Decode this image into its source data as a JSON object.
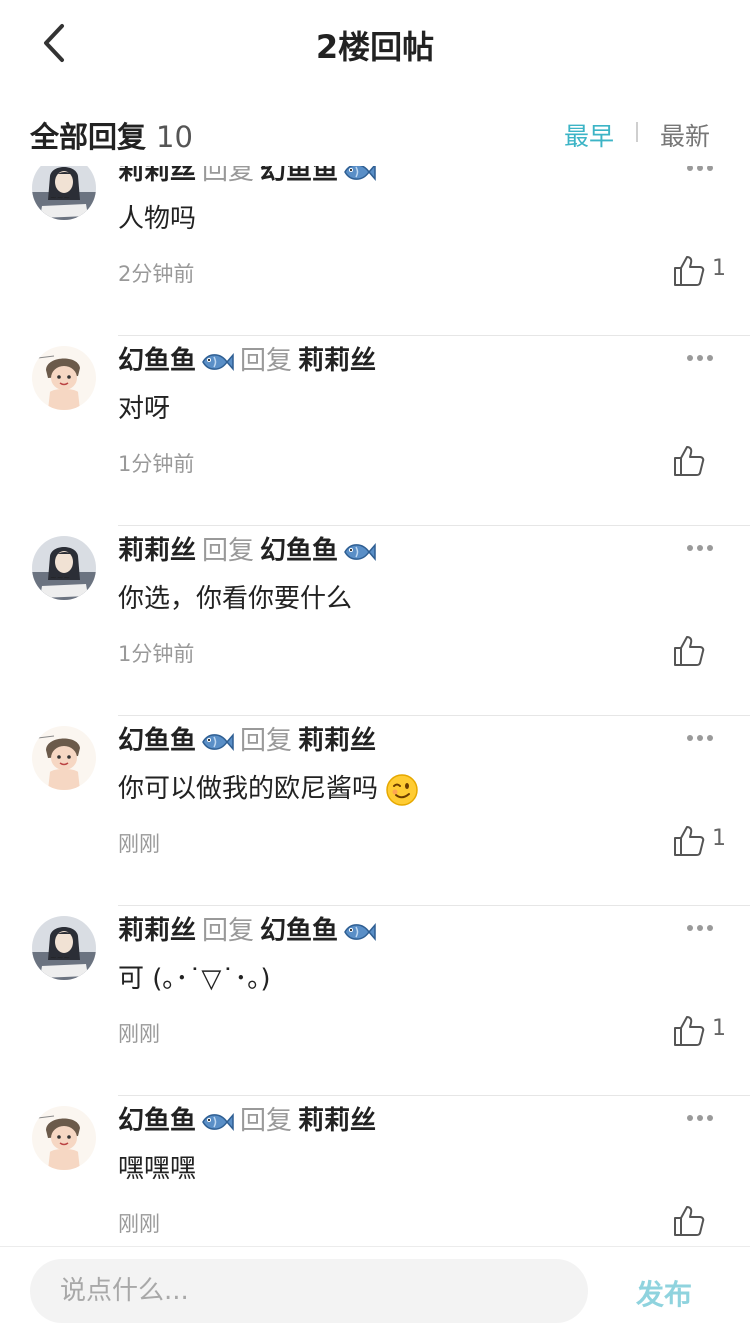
{
  "header": {
    "title": "2楼回帖"
  },
  "subheader": {
    "label": "全部回复",
    "count": "10",
    "sort_earliest": "最早",
    "sort_latest": "最新"
  },
  "reply_word": "回复",
  "replies": [
    {
      "author": "莉莉丝",
      "author_fish": false,
      "target": "幻鱼鱼",
      "target_fish": true,
      "content": "人物吗",
      "time": "2分钟前",
      "likes": "1",
      "avatar": "lilisi"
    },
    {
      "author": "幻鱼鱼",
      "author_fish": true,
      "target": "莉莉丝",
      "target_fish": false,
      "content": "对呀",
      "time": "1分钟前",
      "likes": "",
      "avatar": "huanyuyu"
    },
    {
      "author": "莉莉丝",
      "author_fish": false,
      "target": "幻鱼鱼",
      "target_fish": true,
      "content": "你选，你看你要什么",
      "time": "1分钟前",
      "likes": "",
      "avatar": "lilisi"
    },
    {
      "author": "幻鱼鱼",
      "author_fish": true,
      "target": "莉莉丝",
      "target_fish": false,
      "content": "你可以做我的欧尼酱吗",
      "emoji": "wink",
      "time": "刚刚",
      "likes": "1",
      "avatar": "huanyuyu"
    },
    {
      "author": "莉莉丝",
      "author_fish": false,
      "target": "幻鱼鱼",
      "target_fish": true,
      "content": "可 (｡･˙▽˙･｡)",
      "time": "刚刚",
      "likes": "1",
      "avatar": "lilisi"
    },
    {
      "author": "幻鱼鱼",
      "author_fish": true,
      "target": "莉莉丝",
      "target_fish": false,
      "content": "嘿嘿嘿",
      "time": "刚刚",
      "likes": "",
      "avatar": "huanyuyu"
    }
  ],
  "composer": {
    "placeholder": "说点什么...",
    "publish_label": "发布"
  },
  "icons": {
    "back": "chevron-left-icon",
    "more": "more-dots-icon",
    "like": "thumbs-up-icon",
    "fish": "fish-icon",
    "wink": "wink-emoji-icon"
  },
  "colors": {
    "accent": "#3cb4c6",
    "publish": "#8fd3de",
    "muted": "#999999"
  }
}
